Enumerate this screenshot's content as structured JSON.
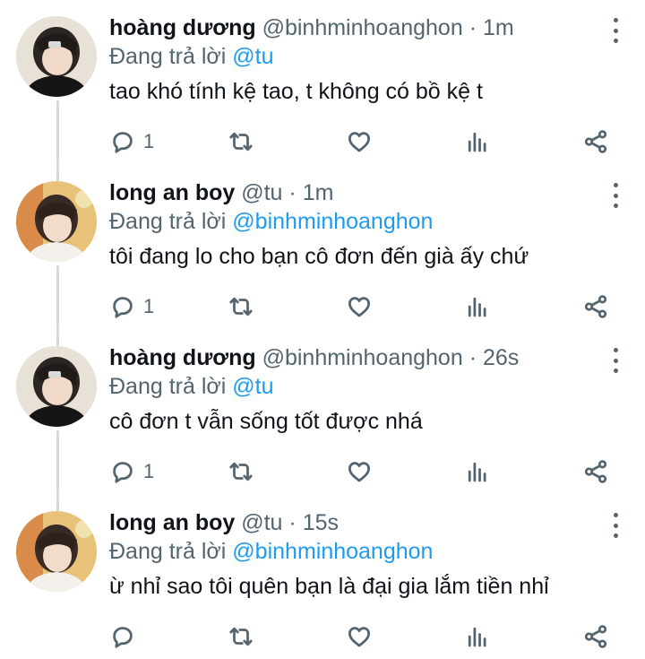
{
  "reply_prefix": "Đang trả lời",
  "tweets": [
    {
      "name": "hoàng dương",
      "handle": "@binhminhoanghon",
      "separator": "·",
      "time": "1m",
      "reply_to": "@tu",
      "text": "tao khó tính kệ tao, t không có bồ kệ t",
      "reply_count": "1",
      "avatar": "avatar-a"
    },
    {
      "name": "long an boy",
      "handle": "@tu",
      "separator": "·",
      "time": "1m",
      "reply_to": "@binhminhoanghon",
      "text": "tôi đang lo cho bạn cô đơn đến già ấy chứ",
      "reply_count": "1",
      "avatar": "avatar-b"
    },
    {
      "name": "hoàng dương",
      "handle": "@binhminhoanghon",
      "separator": "·",
      "time": "26s",
      "reply_to": "@tu",
      "text": "cô đơn t vẫn sống tốt được nhá",
      "reply_count": "1",
      "avatar": "avatar-a"
    },
    {
      "name": "long an boy",
      "handle": "@tu",
      "separator": "·",
      "time": "15s",
      "reply_to": "@binhminhoanghon",
      "text": "ừ nhỉ sao tôi quên bạn là đại gia lắm tiền nhỉ",
      "reply_count": "",
      "avatar": "avatar-b"
    }
  ],
  "icons": {
    "reply": "reply-icon",
    "retweet": "retweet-icon",
    "like": "heart-icon",
    "views": "views-icon",
    "share": "share-icon",
    "more": "more-icon"
  },
  "colors": {
    "mention": "#1d9bf0",
    "secondary_text": "#536471",
    "thread_line": "#cfd9de"
  }
}
